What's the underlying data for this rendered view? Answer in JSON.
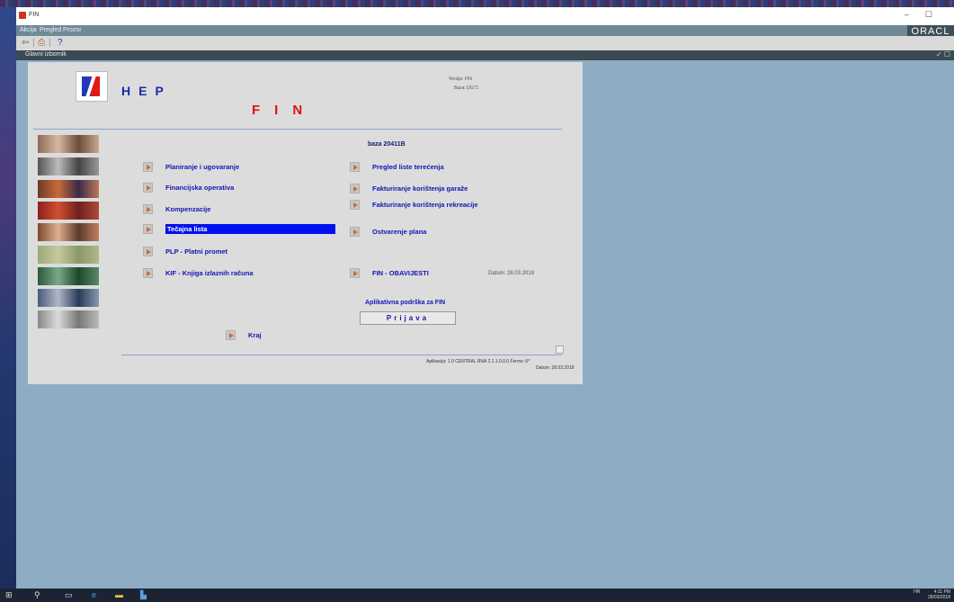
{
  "window": {
    "title": "FIN",
    "controls": [
      "–",
      "☐"
    ],
    "brand": "ORACL"
  },
  "menubar": [
    "Akcija",
    "Pregled",
    "Prozor"
  ],
  "toolbar": {
    "icons": [
      "exit-icon",
      "separator",
      "print-icon",
      "separator",
      "help-icon"
    ],
    "help": "?"
  },
  "inner_window": {
    "title": "Glavni izbornik",
    "controls": "✓ ☐"
  },
  "header": {
    "logo_text": "HEP",
    "app_name": "FIN",
    "info_lines": [
      "Verzija: FIN",
      "Baza: DG71"
    ],
    "baza": "baza 20411B"
  },
  "photos": [
    "people-photo",
    "teamwork-photo",
    "meeting-photo",
    "red-photo",
    "group-photo",
    "landscape-photo",
    "green-photo",
    "workers-photo",
    "money-photo"
  ],
  "menu_left": [
    {
      "label": "Planiranje i ugovaranje",
      "selected": false
    },
    {
      "label": "Financijska operativa",
      "selected": false
    },
    {
      "label": "Kompenzacije",
      "selected": false
    },
    {
      "label": "Tečajna lista",
      "selected": true
    },
    {
      "label": "PLP - Platni promet",
      "selected": false
    },
    {
      "label": "KIF - Knjiga izlaznih računa",
      "selected": false
    }
  ],
  "menu_right": [
    {
      "label": "Pregled liste terećenja"
    },
    {
      "label": "Fakturiranje korištenja garaže"
    },
    {
      "label": "Fakturiranje korištenja rekreacije"
    },
    {
      "label": "Ostvarenje plana"
    },
    {
      "label": "FIN - OBAVIJESTI"
    }
  ],
  "datum": "Datum: 28.03.2018",
  "support": {
    "label": "Aplikativna podrška za FIN",
    "button": "Prijava"
  },
  "exit_label": "Kraj",
  "footer": {
    "line1": "Aplikacija: 1.0 CENTRAL RNA 2.1.1.0.0.0 Forms: 6*",
    "line2": "Datum: 28.03.2018"
  },
  "taskbar": {
    "icons": [
      "windows-start-icon",
      "search-icon",
      "task-view-icon",
      "ie-icon",
      "explorer-icon",
      "java-icon"
    ],
    "tray": [
      "HR",
      "4:11 PM",
      "28/03/2018"
    ]
  }
}
